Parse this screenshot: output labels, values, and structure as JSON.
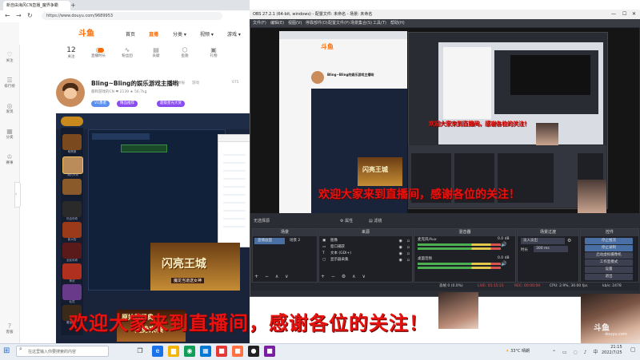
{
  "browser": {
    "tab_title": "新自由海风CN直播_魔界争霸",
    "new_tab": "+",
    "url": "https://www.douyu.com/9689953",
    "nav": {
      "back": "←",
      "forward": "→",
      "reload": "↻"
    }
  },
  "rail": {
    "items": [
      {
        "label": "关注",
        "icon": "heart-icon"
      },
      {
        "label": "排行榜",
        "icon": "list-icon"
      },
      {
        "label": "发现",
        "icon": "compass-icon"
      },
      {
        "label": "分类",
        "icon": "grid-icon"
      },
      {
        "label": "赛事",
        "icon": "trophy-icon"
      },
      {
        "label": "客服",
        "icon": "help-icon"
      }
    ]
  },
  "site": {
    "logo": "斗鱼",
    "nav": [
      "首页",
      "直播",
      "分类 ▾",
      "视频 ▾",
      "游戏 ▾"
    ],
    "active_nav": "直播"
  },
  "room_stats": [
    {
      "value": "12",
      "label": "关注"
    },
    {
      "value": "",
      "label": "直播时长"
    },
    {
      "value": "",
      "label": "粉丝团"
    },
    {
      "value": "",
      "label": "贡献"
    },
    {
      "value": "",
      "label": "鱼翅"
    },
    {
      "value": "",
      "label": "礼物"
    }
  ],
  "host": {
    "name": "Bling~Bling的娱乐游戏主播哟",
    "meta": "都和游戏的CN  ❤ 2139  ★ 56.7kg",
    "badges": [
      "V1勇者",
      "精品推荐",
      "超级星光大赏"
    ],
    "tags": [
      "举报",
      "游戏",
      "6T5"
    ]
  },
  "stream": {
    "sidebar_games": [
      "暗黑服",
      "我的大哥",
      "",
      "热血传奇",
      "新大陆",
      "全民传奇",
      "神武",
      "仙境",
      "",
      "",
      "屠龙战士"
    ],
    "promo_title": "闪亮王城",
    "promo_subtitle": "魔龙当道送女神",
    "promo2_title": "原始即经典",
    "promo2_subtitle": "强势来袭"
  },
  "obs": {
    "title": "OBS 27.2.1 (64-bit, windows) - 配置文件: 未命名 - 场景: 未命名",
    "menu": [
      "文件(F)",
      "编辑(E)",
      "视图(V)",
      "停靠部件(D)",
      "配置文件(P)",
      "场景集合(S)",
      "工具(T)",
      "帮助(H)"
    ],
    "panel_header": "无选择源",
    "tabs": {
      "properties": "属性",
      "filters": "滤镜"
    },
    "scenes": {
      "title": "场景",
      "items": [
        "直播画面",
        "场景 2"
      ]
    },
    "sources": {
      "title": "来源",
      "items": [
        "图像",
        "窗口捕获",
        "文本 (GDI+)",
        "显示器采集"
      ]
    },
    "mixer": {
      "title": "混音器",
      "tracks": [
        {
          "name": "麦克风/Aux",
          "db": "0.0 dB"
        },
        {
          "name": "桌面音频",
          "db": "0.0 dB"
        }
      ]
    },
    "transitions": {
      "title": "场景过渡",
      "mode": "淡入淡出",
      "duration_label": "时长",
      "duration": "300 ms"
    },
    "controls": {
      "title": "控件",
      "buttons": [
        "停止推流",
        "停止录制",
        "启动虚拟摄像机",
        "工作室模式",
        "设置",
        "退出"
      ]
    },
    "status": {
      "drop": "丢帧 0 (0.0%)",
      "live": "LIVE: 01:15:21",
      "rec": "REC: 00:00:00",
      "cpu": "CPU: 2.9%, 30.00 fps",
      "bitrate": "kb/s: 2478"
    }
  },
  "overlay": {
    "big": "欢迎大家来到直播间，感谢各位的关注！",
    "mid": "欢迎大家来到直播间，感谢各位的关注！",
    "small": "欢迎大家来到直播间，感谢各位的关注！",
    "watermark": "斗鱼",
    "watermark_sub": "douyu.com"
  },
  "taskbar": {
    "search_placeholder": "在这里输入你要搜索的内容",
    "weather": "33°C 晴朗",
    "time": "21:15",
    "date": "2022/7/25"
  },
  "colors": {
    "brand": "#ff6a00",
    "overlay_red": "#e8130e",
    "obs_bg": "#2b2d35"
  }
}
